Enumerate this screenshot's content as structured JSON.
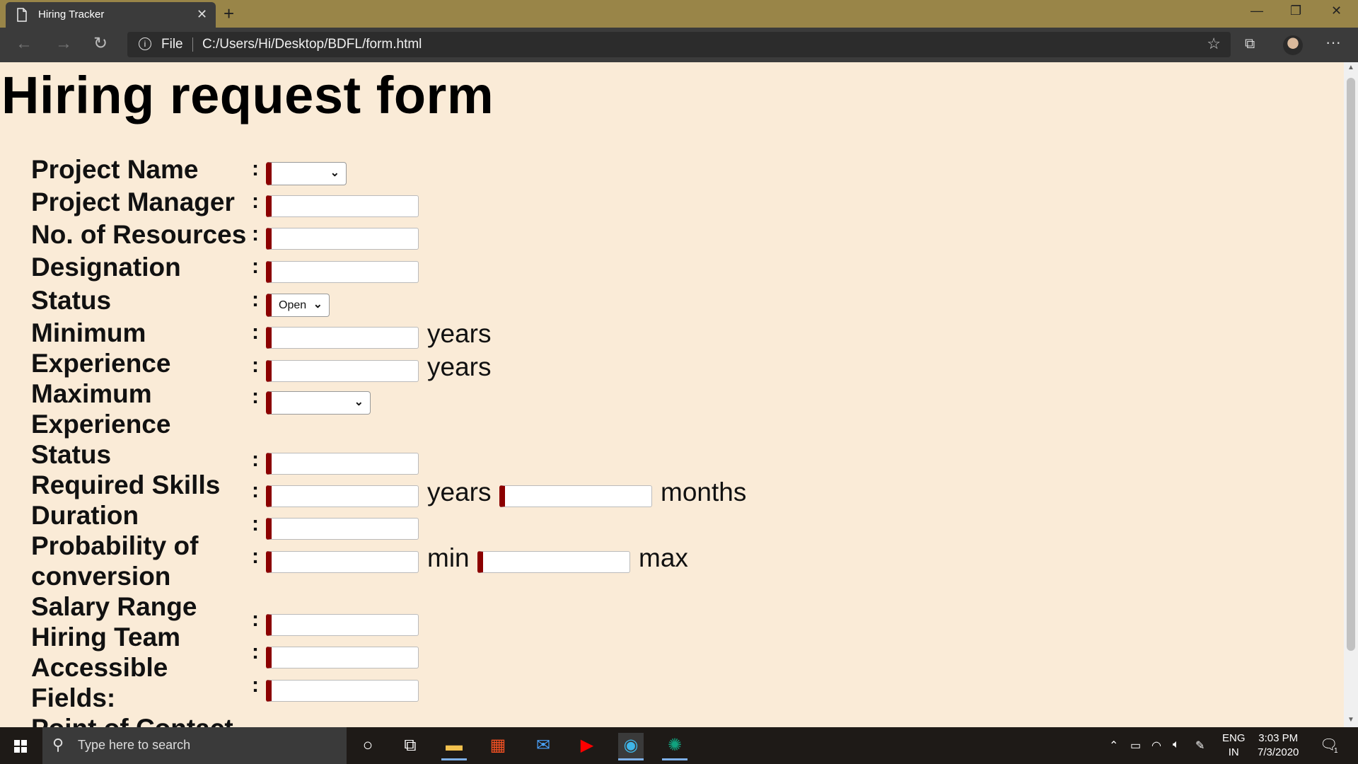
{
  "browser": {
    "tab_title": "Hiring Tracker",
    "tab_close": "✕",
    "new_tab": "+",
    "file_label": "File",
    "url": "C:/Users/Hi/Desktop/BDFL/form.html",
    "window_controls": {
      "minimize": "—",
      "restore": "❐",
      "close": "✕"
    },
    "icons": [
      "page-icon",
      "back-icon",
      "forward-icon",
      "refresh-icon",
      "info-icon",
      "star-icon",
      "collections-icon",
      "profile-avatar",
      "more-icon"
    ]
  },
  "form": {
    "title": "Hiring request form",
    "colon": ":",
    "labels": {
      "project_name": "Project Name",
      "project_manager": "Project Manager",
      "no_of_resources": "No. of Resources",
      "designation": "Designation",
      "status": "Status",
      "minimum": "Minimum",
      "experience": "Experience",
      "maximum": "Maximum",
      "experience2": "Experience",
      "status2": "Status",
      "required_skills": "Required Skills",
      "duration": "Duration",
      "probability_of": "Probability of",
      "conversion": "conversion",
      "salary_range": "Salary Range",
      "hiring_team": "Hiring Team",
      "accessible": "Accessible",
      "fields": "Fields:",
      "point_of_contact": "Point of Contact"
    },
    "status_selected": "Open",
    "units": {
      "years": "years",
      "months": "months",
      "min": "min",
      "max": "max"
    }
  },
  "taskbar": {
    "search_placeholder": "Type here to search",
    "lang_top": "ENG",
    "lang_bottom": "IN",
    "time": "3:03 PM",
    "date": "7/3/2020",
    "notification_count": "1",
    "icons": [
      "windows-start-icon",
      "search-icon",
      "cortana-icon",
      "task-view-icon",
      "file-explorer-icon",
      "store-icon",
      "mail-icon",
      "youtube-icon",
      "edge-icon",
      "chatgpt-icon"
    ]
  }
}
